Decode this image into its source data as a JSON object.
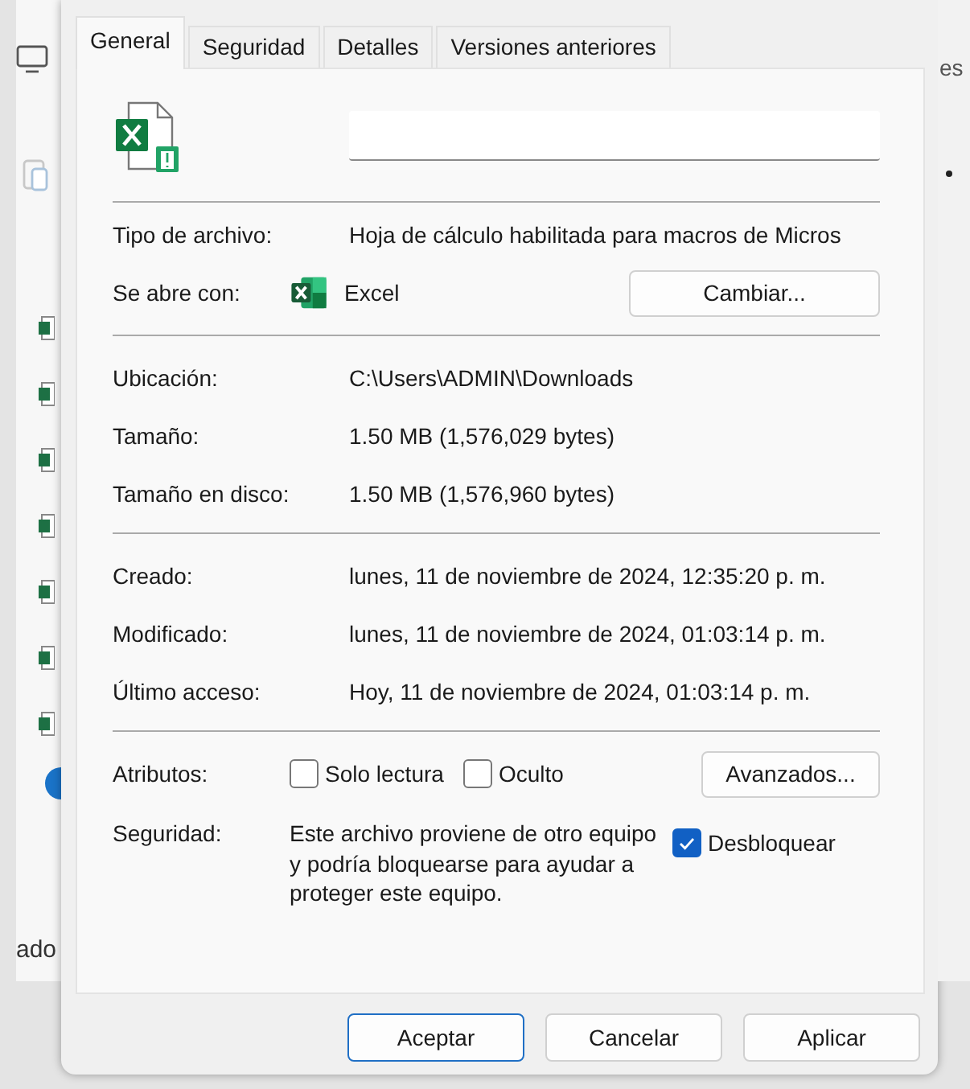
{
  "background": {
    "right_text": "es",
    "left_text": "ado"
  },
  "tabs": [
    {
      "label": "General",
      "selected": true
    },
    {
      "label": "Seguridad",
      "selected": false
    },
    {
      "label": "Detalles",
      "selected": false
    },
    {
      "label": "Versiones anteriores",
      "selected": false
    }
  ],
  "sections": [
    {
      "rows": [
        {
          "kind": "text",
          "label": "Tipo de archivo:",
          "value": "Hoja de cálculo habilitada para macros de Micros"
        },
        {
          "kind": "app",
          "label": "Se abre con:",
          "value": "Excel",
          "button": "Cambiar..."
        }
      ]
    },
    {
      "rows": [
        {
          "kind": "text",
          "label": "Ubicación:",
          "value": "C:\\Users\\ADMIN\\Downloads"
        },
        {
          "kind": "text",
          "label": "Tamaño:",
          "value": "1.50 MB (1,576,029 bytes)"
        },
        {
          "kind": "text",
          "label": "Tamaño en disco:",
          "value": "1.50 MB (1,576,960 bytes)"
        }
      ]
    },
    {
      "rows": [
        {
          "kind": "text",
          "label": "Creado:",
          "value": "lunes, 11 de noviembre de 2024, 12:35:20 p. m."
        },
        {
          "kind": "text",
          "label": "Modificado:",
          "value": "lunes, 11 de noviembre de 2024, 01:03:14 p. m."
        },
        {
          "kind": "text",
          "label": "Último acceso:",
          "value": "Hoy, 11 de noviembre de 2024, 01:03:14 p. m."
        }
      ]
    },
    {
      "rows": [
        {
          "kind": "attributes",
          "label": "Atributos:",
          "options": [
            {
              "label": "Solo lectura",
              "checked": false
            },
            {
              "label": "Oculto",
              "checked": false
            }
          ],
          "button": "Avanzados..."
        },
        {
          "kind": "security",
          "label": "Seguridad:",
          "value": "Este archivo proviene de otro equipo y podría bloquearse para ayudar a proteger este equipo.",
          "option": {
            "label": "Desbloquear",
            "checked": true
          }
        }
      ]
    }
  ],
  "buttons": [
    {
      "label": "Aceptar",
      "default": true
    },
    {
      "label": "Cancelar",
      "default": false
    },
    {
      "label": "Aplicar",
      "default": false
    }
  ]
}
